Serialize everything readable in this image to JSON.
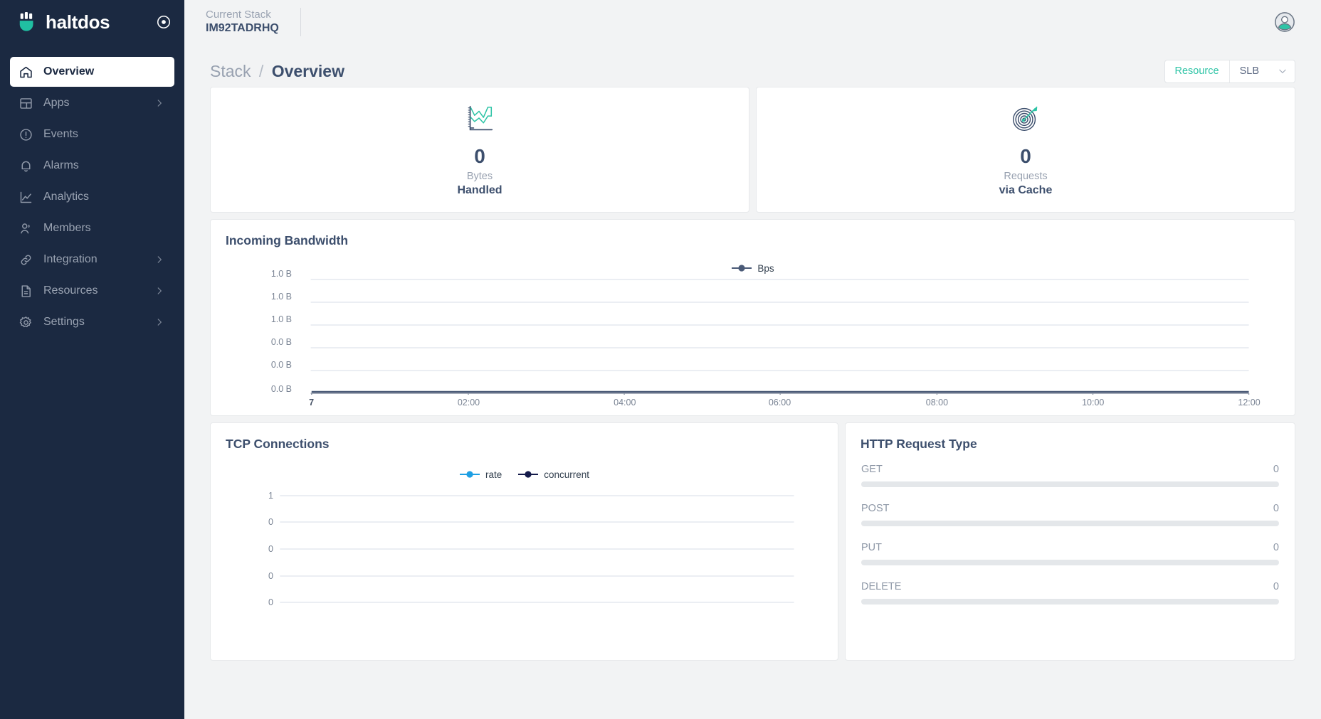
{
  "sidebar": {
    "brand": "haltdos",
    "collapse_icon": "target-circle-icon",
    "items": [
      {
        "label": "Overview",
        "icon": "home-icon",
        "active": true,
        "chevron": false
      },
      {
        "label": "Apps",
        "icon": "layout-icon",
        "active": false,
        "chevron": true
      },
      {
        "label": "Events",
        "icon": "alert-circle-icon",
        "active": false,
        "chevron": false
      },
      {
        "label": "Alarms",
        "icon": "bell-icon",
        "active": false,
        "chevron": false
      },
      {
        "label": "Analytics",
        "icon": "chart-line-icon",
        "active": false,
        "chevron": false
      },
      {
        "label": "Members",
        "icon": "users-icon",
        "active": false,
        "chevron": false
      },
      {
        "label": "Integration",
        "icon": "link-icon",
        "active": false,
        "chevron": true
      },
      {
        "label": "Resources",
        "icon": "document-icon",
        "active": false,
        "chevron": true
      },
      {
        "label": "Settings",
        "icon": "gear-icon",
        "active": false,
        "chevron": true
      }
    ]
  },
  "topbar": {
    "stack_label": "Current Stack",
    "stack_value": "IM92TADRHQ",
    "avatar_icon": "user-avatar-icon"
  },
  "page": {
    "breadcrumb_parent": "Stack",
    "breadcrumb_separator": "/",
    "breadcrumb_current": "Overview"
  },
  "resource_select": {
    "label": "Resource",
    "value": "SLB",
    "chevron_icon": "chevron-down-icon"
  },
  "stats": [
    {
      "icon": "chart-line-card-icon",
      "value": "0",
      "unit": "Bytes",
      "caption": "Handled"
    },
    {
      "icon": "target-arrow-icon",
      "value": "0",
      "unit": "Requests",
      "caption": "via Cache"
    }
  ],
  "panels": {
    "bandwidth_title": "Incoming Bandwidth",
    "tcp_title": "TCP Connections",
    "http_title": "HTTP Request Type"
  },
  "http_request_types": [
    {
      "method": "GET",
      "value": "0",
      "percent": 0
    },
    {
      "method": "POST",
      "value": "0",
      "percent": 0
    },
    {
      "method": "PUT",
      "value": "0",
      "percent": 0
    },
    {
      "method": "DELETE",
      "value": "0",
      "percent": 0
    }
  ],
  "colors": {
    "sidebar_bg": "#1b2941",
    "accent_teal": "#2ec4a6",
    "text_dark": "#3d4f6d",
    "text_muted": "#98a1b0",
    "series_bps": "#4a5a77",
    "series_rate": "#1e9fe3",
    "series_concurrent": "#141a4a",
    "grid": "#dfe3ec"
  },
  "chart_data": [
    {
      "type": "line",
      "title": "Incoming Bandwidth",
      "xlabel": "",
      "ylabel": "",
      "legend": [
        "Bps"
      ],
      "legend_position": "top-center",
      "grid": true,
      "x": [
        "7",
        "02:00",
        "04:00",
        "06:00",
        "08:00",
        "10:00",
        "12:00"
      ],
      "ytick_labels": [
        "1.0 B",
        "1.0 B",
        "1.0 B",
        "0.0 B",
        "0.0 B",
        "0.0 B"
      ],
      "ylim": [
        0,
        1
      ],
      "series": [
        {
          "name": "Bps",
          "color": "#4a5a77",
          "values": [
            0,
            0,
            0,
            0,
            0,
            0,
            0
          ]
        }
      ]
    },
    {
      "type": "line",
      "title": "TCP Connections",
      "xlabel": "",
      "ylabel": "",
      "legend": [
        "rate",
        "concurrent"
      ],
      "legend_position": "top-center",
      "grid": true,
      "x": [
        "",
        "",
        "",
        "",
        "",
        "",
        ""
      ],
      "ytick_labels": [
        "1",
        "0",
        "0",
        "0",
        "0"
      ],
      "ylim": [
        0,
        1
      ],
      "series": [
        {
          "name": "rate",
          "color": "#1e9fe3",
          "values": [
            0,
            0,
            0,
            0,
            0,
            0,
            0
          ]
        },
        {
          "name": "concurrent",
          "color": "#141a4a",
          "values": [
            0,
            0,
            0,
            0,
            0,
            0,
            0
          ]
        }
      ]
    },
    {
      "type": "bar",
      "title": "HTTP Request Type",
      "orientation": "horizontal",
      "categories": [
        "GET",
        "POST",
        "PUT",
        "DELETE"
      ],
      "values": [
        0,
        0,
        0,
        0
      ],
      "xlabel": "",
      "ylabel": "",
      "xlim": [
        0,
        100
      ]
    }
  ]
}
